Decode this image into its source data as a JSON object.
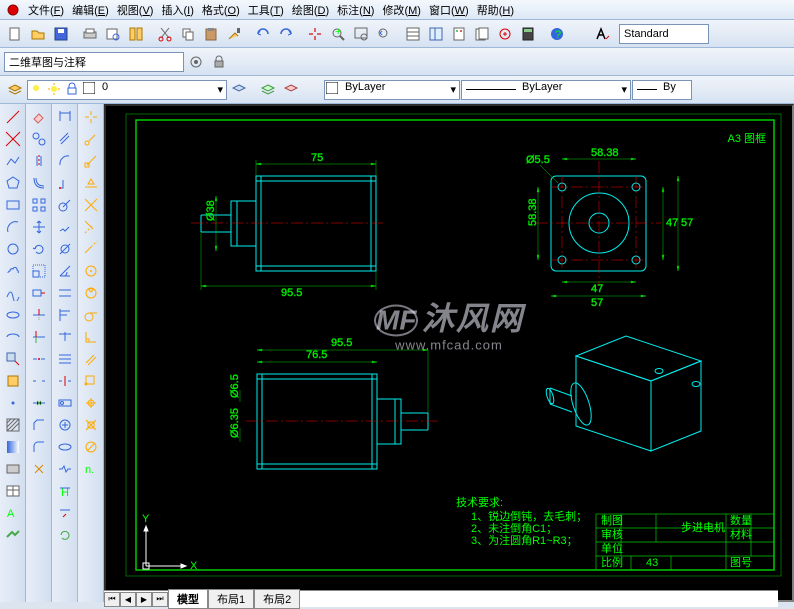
{
  "menubar": {
    "items": [
      {
        "label": "文件",
        "key": "F"
      },
      {
        "label": "编辑",
        "key": "E"
      },
      {
        "label": "视图",
        "key": "V"
      },
      {
        "label": "插入",
        "key": "I"
      },
      {
        "label": "格式",
        "key": "O"
      },
      {
        "label": "工具",
        "key": "T"
      },
      {
        "label": "绘图",
        "key": "D"
      },
      {
        "label": "标注",
        "key": "N"
      },
      {
        "label": "修改",
        "key": "M"
      },
      {
        "label": "窗口",
        "key": "W"
      },
      {
        "label": "帮助",
        "key": "H"
      }
    ]
  },
  "toolbar1": {
    "style_label": "Standard"
  },
  "toolbar2": {
    "workspace": "二维草图与注释"
  },
  "toolbar3": {
    "layer_value": "0",
    "color_label": "ByLayer",
    "linetype_label": "ByLayer",
    "lineweight_label": "By"
  },
  "drawing": {
    "frame_label": "A3 图框",
    "dims": {
      "d1": "75",
      "d2": "95.5",
      "d3": "Ø38",
      "d4": "Ø5.5",
      "d5": "58.38",
      "d6": "58.38",
      "d7": "47",
      "d8": "47",
      "d9": "57",
      "d10": "57",
      "d11": "76.5",
      "d12": "95.5",
      "d13": "Ø6.5",
      "d14": "Ø6.35"
    },
    "tech_title": "技术要求:",
    "tech_lines": [
      "1、锐边倒钝，去毛刺；",
      "2、未注倒角C1；",
      "3、为注圆角R1~R3；"
    ],
    "titleblock": {
      "part_name": "步进电机",
      "scale_value": "43",
      "row1a": "制图",
      "row2a": "审核",
      "row3a": "单位",
      "scale_label": "比例",
      "num_label": "数量",
      "mat_label": "材料",
      "sheet_label": "图号"
    },
    "ucs": {
      "x": "X",
      "y": "Y"
    }
  },
  "tabs": {
    "items": [
      "模型",
      "布局1",
      "布局2"
    ],
    "active": 0
  },
  "watermark": {
    "main": "沐风网",
    "sub": "www.mfcad.com"
  }
}
